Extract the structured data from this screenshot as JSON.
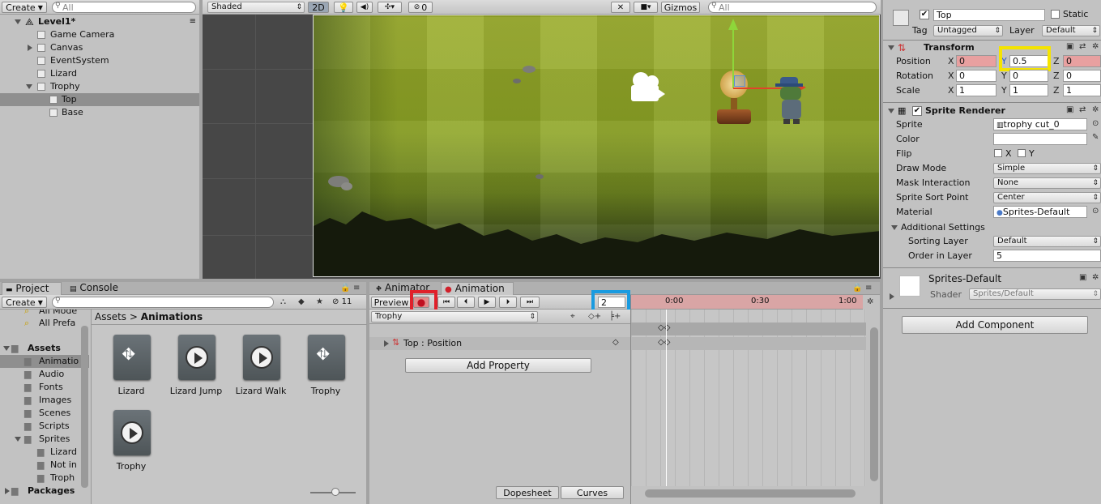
{
  "hierarchy": {
    "create_label": "Create",
    "search_placeholder": "All",
    "scene_name": "Level1*",
    "items": [
      {
        "label": "Game Camera"
      },
      {
        "label": "Canvas"
      },
      {
        "label": "EventSystem"
      },
      {
        "label": "Lizard"
      },
      {
        "label": "Trophy"
      },
      {
        "label": "Top"
      },
      {
        "label": "Base"
      }
    ]
  },
  "scene_toolbar": {
    "shading_mode": "Shaded",
    "mode_2d": "2D",
    "hidden_count": "0",
    "gizmos_label": "Gizmos",
    "search_placeholder": "All"
  },
  "inspector": {
    "object_name": "Top",
    "static_label": "Static",
    "tag_label": "Tag",
    "tag_value": "Untagged",
    "layer_label": "Layer",
    "layer_value": "Default",
    "transform": {
      "title": "Transform",
      "position_label": "Position",
      "rotation_label": "Rotation",
      "scale_label": "Scale",
      "axis_x": "X",
      "axis_y": "Y",
      "axis_z": "Z",
      "position": {
        "x": "0",
        "y": "0.5",
        "z": "0"
      },
      "rotation": {
        "x": "0",
        "y": "0",
        "z": "0"
      },
      "scale": {
        "x": "1",
        "y": "1",
        "z": "1"
      }
    },
    "sprite_renderer": {
      "title": "Sprite Renderer",
      "sprite_label": "Sprite",
      "sprite_value": "trophy cut_0",
      "color_label": "Color",
      "flip_label": "Flip",
      "flip_x": "X",
      "flip_y": "Y",
      "draw_mode_label": "Draw Mode",
      "draw_mode_value": "Simple",
      "mask_label": "Mask Interaction",
      "mask_value": "None",
      "sort_point_label": "Sprite Sort Point",
      "sort_point_value": "Center",
      "material_label": "Material",
      "material_value": "Sprites-Default",
      "additional_label": "Additional Settings",
      "sorting_layer_label": "Sorting Layer",
      "sorting_layer_value": "Default",
      "order_label": "Order in Layer",
      "order_value": "5"
    },
    "material": {
      "name": "Sprites-Default",
      "shader_label": "Shader",
      "shader_value": "Sprites/Default"
    },
    "add_component_label": "Add Component"
  },
  "project": {
    "tab_project": "Project",
    "tab_console": "Console",
    "create_label": "Create",
    "hidden_count": "11",
    "tree": [
      {
        "label": "All Mode"
      },
      {
        "label": "All Prefa"
      },
      {
        "label": "Assets"
      },
      {
        "label": "Animatio"
      },
      {
        "label": "Audio"
      },
      {
        "label": "Fonts"
      },
      {
        "label": "Images"
      },
      {
        "label": "Scenes"
      },
      {
        "label": "Scripts"
      },
      {
        "label": "Sprites"
      },
      {
        "label": "Lizard"
      },
      {
        "label": "Not in"
      },
      {
        "label": "Troph"
      },
      {
        "label": "Packages"
      }
    ],
    "breadcrumb_root": "Assets",
    "breadcrumb_sep": ">",
    "breadcrumb_current": "Animations",
    "assets": [
      {
        "label": "Lizard",
        "icon": "animator-controller-icon"
      },
      {
        "label": "Lizard Jump",
        "icon": "animation-clip-icon"
      },
      {
        "label": "Lizard Walk",
        "icon": "animation-clip-icon"
      },
      {
        "label": "Trophy",
        "icon": "animator-controller-icon"
      },
      {
        "label": "Trophy",
        "icon": "animation-clip-icon"
      }
    ]
  },
  "animation": {
    "tab_animator": "Animator",
    "tab_animation": "Animation",
    "preview_label": "Preview",
    "frame_value": "2",
    "clip_value": "Trophy",
    "property_label": "Top : Position",
    "add_property_label": "Add Property",
    "dopesheet_label": "Dopesheet",
    "curves_label": "Curves",
    "timeline_marks": [
      "0:00",
      "0:30",
      "1:00"
    ]
  },
  "highlights": {
    "yellow": "#f5e400",
    "red": "#e0202a",
    "blue": "#1a9be0"
  }
}
